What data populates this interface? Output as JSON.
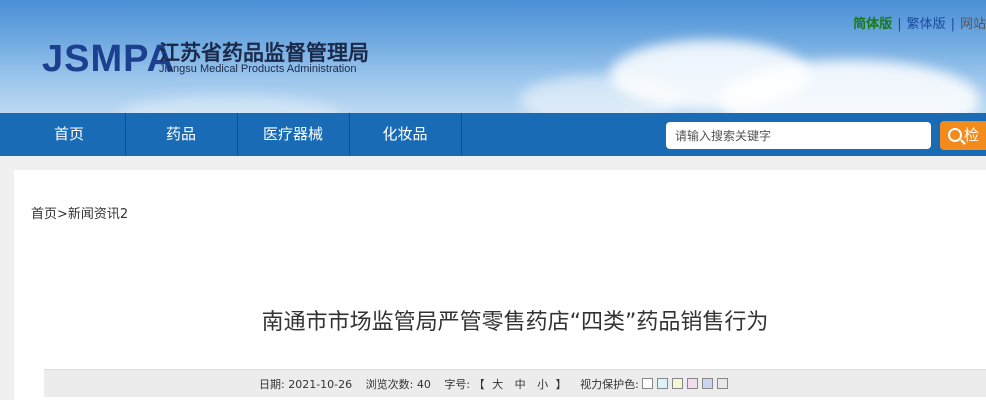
{
  "header": {
    "logo_abbr": "JSMPA",
    "logo_cn": "江苏省药品监督管理局",
    "logo_en": "Jiangsu Medical Products Administration",
    "lang": {
      "simplified": "简体版",
      "separator": "|",
      "traditional": "繁体版",
      "site": "网站"
    }
  },
  "nav": {
    "items": [
      {
        "label": "首页"
      },
      {
        "label": "药品"
      },
      {
        "label": "医疗器械"
      },
      {
        "label": "化妆品"
      }
    ]
  },
  "search": {
    "placeholder": "请输入搜索关键字",
    "button_label": "检"
  },
  "breadcrumb": "首页>新闻资讯2",
  "article": {
    "title": "南通市市场监管局严管零售药店“四类”药品销售行为",
    "meta": {
      "date_label": "日期:",
      "date": "2021-10-26",
      "views_label": "浏览次数:",
      "views": "40",
      "font_size_label": "字号:",
      "bracket_open": "【",
      "size_large": "大",
      "size_medium": "中",
      "size_small": "小",
      "bracket_close": "】",
      "eye_care_label": "视力保护色:",
      "eye_care_colors": [
        "#ffffff",
        "#ddf2f7",
        "#f7f6d6",
        "#f2ddec",
        "#c9d5f0",
        "#e8e8e8"
      ]
    }
  },
  "colors": {
    "nav_bg": "#1a6bb5",
    "search_button": "#f28a1c",
    "logo_blue": "#1c3f8f"
  }
}
